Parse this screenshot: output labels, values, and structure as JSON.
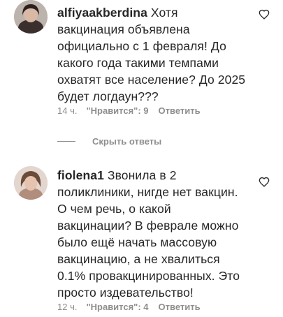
{
  "comments": [
    {
      "username": "alfiyaakberdina",
      "text": "Хотя\nвакцинация объявлена\nофициально с 1 февраля! До\nкакого года такими темпами\nохватят все население? До 2025\nбудет логдаун???",
      "time": "14 ч.",
      "likes": "\"Нравится\": 9",
      "reply_label": "Ответить",
      "like_icon": "heart-outline-icon"
    },
    {
      "username": "fiolena1",
      "text": "Звонила в 2\nполиклиники, нигде нет вакцин.\nО чем речь, о какой\nвакцинации? В феврале можно\nбыло ещё начать массовую\nвакцинацию, а не хвалиться\n0.1% провакцинированных. Это\nпросто издевательство!",
      "time": "12 ч.",
      "likes": "\"Нравится\": 4",
      "reply_label": "Ответить",
      "like_icon": "heart-outline-icon"
    }
  ],
  "hide_replies_label": "Скрыть ответы",
  "colors": {
    "text": "#262626",
    "secondary": "#8e8e8e",
    "background": "#ffffff"
  }
}
